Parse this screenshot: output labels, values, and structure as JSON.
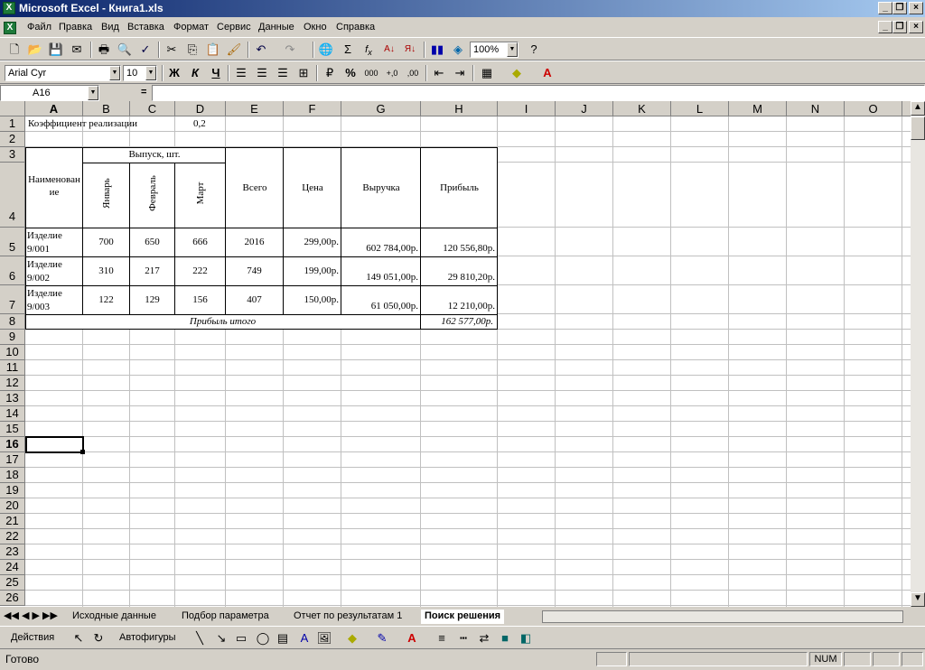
{
  "window": {
    "title": "Microsoft Excel - Книга1.xls"
  },
  "menu": [
    "Файл",
    "Правка",
    "Вид",
    "Вставка",
    "Формат",
    "Сервис",
    "Данные",
    "Окно",
    "Справка"
  ],
  "toolbar": {
    "zoom": "100%",
    "font_name": "Arial Cyr",
    "font_size": "10",
    "bold": "Ж",
    "italic": "К",
    "underline": "Ч",
    "percent": "%",
    "thousands": "000"
  },
  "formula_bar": {
    "name_box": "A16",
    "equals": "=",
    "content": ""
  },
  "columns": [
    "A",
    "B",
    "C",
    "D",
    "E",
    "F",
    "G",
    "H",
    "I",
    "J",
    "K",
    "L",
    "M",
    "N",
    "O"
  ],
  "rows": [
    "1",
    "2",
    "3",
    "4",
    "5",
    "6",
    "7",
    "8",
    "9",
    "10",
    "11",
    "12",
    "13",
    "14",
    "15",
    "16",
    "17",
    "18",
    "19",
    "20",
    "21",
    "22",
    "23",
    "24",
    "25",
    "26"
  ],
  "cells": {
    "a1": "Коэффициент реализации",
    "d1": "0,2",
    "b3": "Выпуск, шт.",
    "a3": "Наименование",
    "e3": "Всего",
    "f3": "Цена",
    "g3": "Выручка",
    "h3": "Прибыль",
    "b4": "Январь",
    "c4": "Февраль",
    "d4": "Март",
    "a5": "Изделие 9/001",
    "b5": "700",
    "c5": "650",
    "d5": "666",
    "e5": "2016",
    "f5": "299,00р.",
    "g5": "602 784,00р.",
    "h5": "120 556,80р.",
    "a6": "Изделие 9/002",
    "b6": "310",
    "c6": "217",
    "d6": "222",
    "e6": "749",
    "f6": "199,00р.",
    "g6": "149 051,00р.",
    "h6": "29 810,20р.",
    "a7": "Изделие 9/003",
    "b7": "122",
    "c7": "129",
    "d7": "156",
    "e7": "407",
    "f7": "150,00р.",
    "g7": "61 050,00р.",
    "h7": "12 210,00р.",
    "a8": "Прибыль итого",
    "h8": "162 577,00р."
  },
  "sheet_tabs": [
    "Исходные данные",
    "Подбор параметра",
    "Отчет по результатам 1",
    "Поиск решения"
  ],
  "drawing": {
    "actions": "Действия",
    "autoshapes": "Автофигуры"
  },
  "status": {
    "ready": "Готово",
    "num": "NUM"
  }
}
